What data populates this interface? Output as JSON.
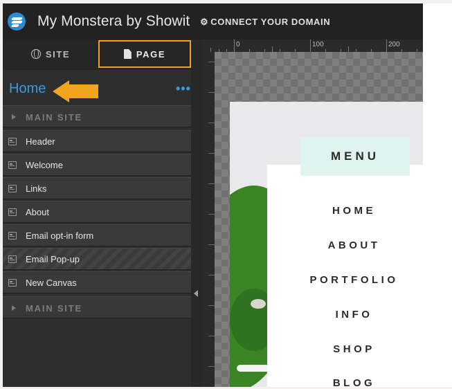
{
  "app": {
    "title": "My Monstera by Showit",
    "connect_label": "CONNECT YOUR DOMAIN"
  },
  "tabs": {
    "site": "SITE",
    "page": "PAGE"
  },
  "page": {
    "name": "Home",
    "more": "•••"
  },
  "sections": {
    "first": "MAIN SITE",
    "second": "MAIN SITE"
  },
  "canvases": [
    {
      "label": "Header"
    },
    {
      "label": "Welcome"
    },
    {
      "label": "Links"
    },
    {
      "label": "About"
    },
    {
      "label": "Email opt-in form"
    },
    {
      "label": "Email Pop-up"
    },
    {
      "label": "New Canvas"
    }
  ],
  "ruler": {
    "marks": [
      "0",
      "100",
      "200"
    ]
  },
  "preview": {
    "menu_title": "MENU",
    "items": [
      "HOME",
      "ABOUT",
      "PORTFOLIO",
      "INFO",
      "SHOP",
      "BLOG"
    ]
  },
  "colors": {
    "accent": "#f2a41c",
    "link": "#3b9be0",
    "brand": "#2f8bd1"
  }
}
